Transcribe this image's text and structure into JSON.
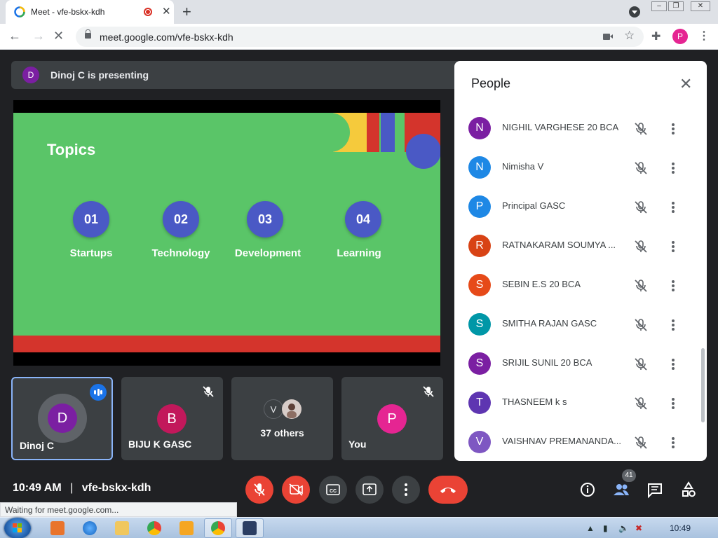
{
  "browser": {
    "tab_title": "Meet - vfe-bskx-kdh",
    "tab_close": "✕",
    "new_tab": "+",
    "url": "meet.google.com/vfe-bskx-kdh",
    "profile_initial": "P",
    "status_text": "Waiting for meet.google.com..."
  },
  "banner": {
    "presenter_initial": "D",
    "text": "Dinoj C is presenting"
  },
  "slide": {
    "title": "Topics",
    "topics": [
      {
        "number": "01",
        "label": "Startups"
      },
      {
        "number": "02",
        "label": "Technology"
      },
      {
        "number": "03",
        "label": "Development"
      },
      {
        "number": "04",
        "label": "Learning"
      }
    ]
  },
  "tiles": [
    {
      "initial": "D",
      "name": "Dinoj C",
      "color": "#7b1fa2",
      "state": "speaking"
    },
    {
      "initial": "B",
      "name": "BIJU K GASC",
      "color": "#c2185b",
      "state": "muted"
    },
    {
      "label": "37 others",
      "mini_initial": "V"
    },
    {
      "initial": "P",
      "name": "You",
      "color": "#e52592",
      "state": "muted"
    }
  ],
  "people": {
    "title": "People",
    "list": [
      {
        "initial": "N",
        "name": "NIGHIL VARGHESE 20 BCA",
        "color": "#7b1fa2"
      },
      {
        "initial": "N",
        "name": "Nimisha V",
        "color": "#1e88e5"
      },
      {
        "initial": "P",
        "name": "Principal GASC",
        "color": "#1e88e5"
      },
      {
        "initial": "R",
        "name": "RATNAKARAM SOUMYA ...",
        "color": "#d84315"
      },
      {
        "initial": "S",
        "name": "SEBIN E.S 20 BCA",
        "color": "#e64a19"
      },
      {
        "initial": "S",
        "name": "SMITHA RAJAN GASC",
        "color": "#0097a7"
      },
      {
        "initial": "S",
        "name": "SRIJIL SUNIL 20 BCA",
        "color": "#7b1fa2"
      },
      {
        "initial": "T",
        "name": "THASNEEM k s",
        "color": "#5e35b1"
      },
      {
        "initial": "V",
        "name": "VAISHNAV PREMANANDA...",
        "color": "#7e57c2"
      }
    ]
  },
  "footer": {
    "time": "10:49 AM",
    "separator": "|",
    "meeting_code": "vfe-bskx-kdh",
    "participants_count": "41"
  },
  "taskbar": {
    "clock": "10:49"
  },
  "colors": {
    "meet_bg": "#202124",
    "red_button": "#ea4335",
    "accent_blue": "#1a73e8",
    "slide_green": "#5ac568",
    "slide_blue": "#4a59c5"
  }
}
